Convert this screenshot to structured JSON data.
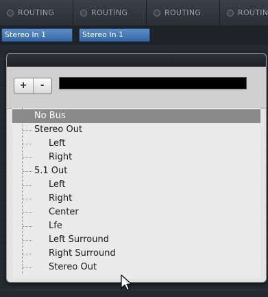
{
  "routing": {
    "labels": [
      "ROUTING",
      "ROUTING",
      "ROUTING",
      "ROUTIN"
    ]
  },
  "inputs": {
    "buttons": [
      "Stereo In 1",
      "Stereo In 1"
    ]
  },
  "toolbar": {
    "plus_label": "+",
    "minus_label": "-",
    "search_value": ""
  },
  "tree": {
    "items": [
      {
        "label": "No Bus",
        "selected": true
      },
      {
        "label": "Stereo Out"
      },
      {
        "label": "Left"
      },
      {
        "label": "Right"
      },
      {
        "label": "5.1 Out"
      },
      {
        "label": "Left"
      },
      {
        "label": "Right"
      },
      {
        "label": "Center"
      },
      {
        "label": "Lfe"
      },
      {
        "label": "Left Surround"
      },
      {
        "label": "Right Surround"
      },
      {
        "label": "Stereo Out"
      }
    ]
  },
  "icons": {
    "cursor": "mouse-pointer-icon",
    "routing_led": "routing-led-icon"
  },
  "colors": {
    "selected_row": "#8a8a8a",
    "input_button": "#3468a8",
    "search_field": "#000000"
  }
}
